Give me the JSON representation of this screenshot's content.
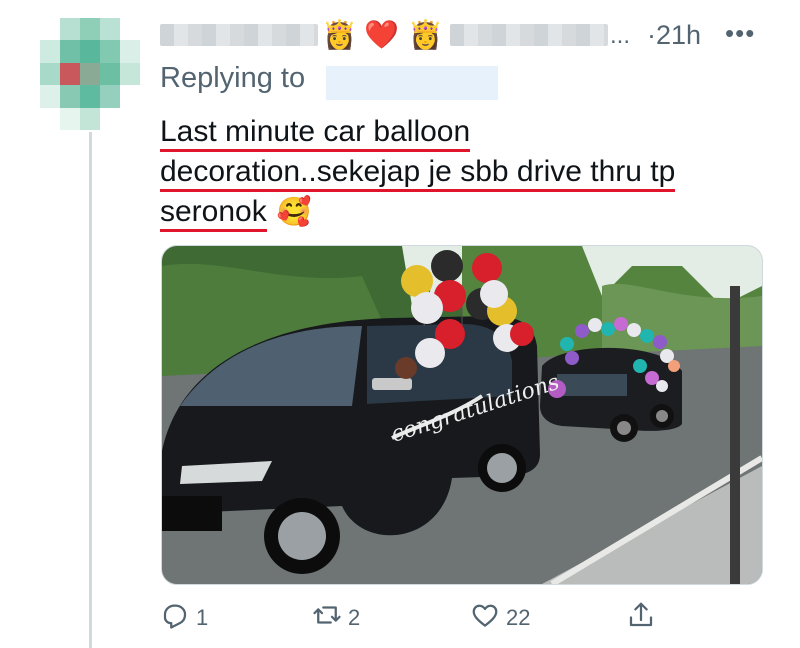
{
  "tweet": {
    "time": "21h",
    "separator": "·",
    "name_ellipsis": "...",
    "name_emojis": [
      "👸",
      "❤️",
      "👸"
    ],
    "replying_label": "Replying to",
    "text_lines": [
      "Last minute car balloon",
      "decoration..sekejap je sbb drive thru tp",
      "seronok"
    ],
    "text_emoji": "🥰",
    "media": {
      "banner_text": "congratulations"
    }
  },
  "actions": {
    "reply_count": "1",
    "retweet_count": "2",
    "like_count": "22"
  },
  "icons": {
    "more": "more-dots-icon",
    "reply": "reply-icon",
    "retweet": "retweet-icon",
    "like": "heart-icon",
    "share": "share-icon"
  },
  "colors": {
    "secondary_text": "#536471",
    "underline": "#e0142a",
    "thread_line": "#cfd9de"
  }
}
